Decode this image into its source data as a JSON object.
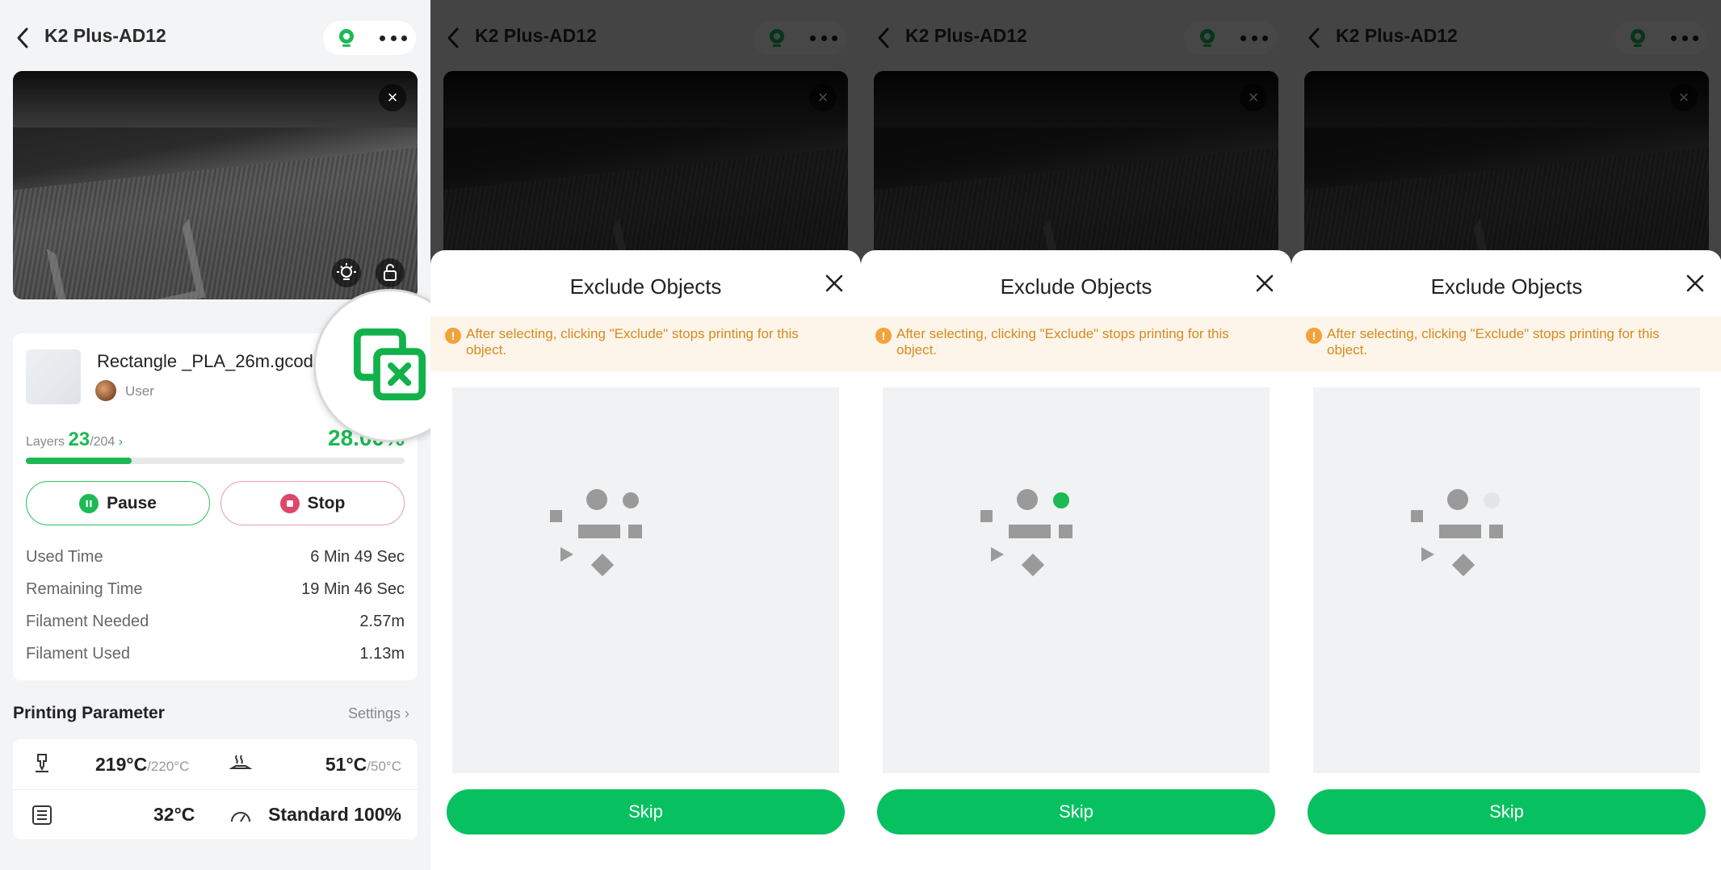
{
  "header": {
    "title": "K2 Plus-AD12"
  },
  "job": {
    "file_name": "Rectangle _PLA_26m.gcode",
    "user": "User",
    "layers_label": "Layers",
    "layers_current": "23",
    "layers_total": "/204",
    "percent": "28.00%",
    "progress": 0.28,
    "pause_label": "Pause",
    "stop_label": "Stop"
  },
  "stats": [
    {
      "label": "Used Time",
      "value": "6 Min  49 Sec"
    },
    {
      "label": "Remaining Time",
      "value": "19 Min  46 Sec"
    },
    {
      "label": "Filament Needed",
      "value": "2.57m"
    },
    {
      "label": "Filament Used",
      "value": "1.13m"
    }
  ],
  "params": {
    "title": "Printing Parameter",
    "settings_link": "Settings",
    "nozzle_temp": "219°C",
    "nozzle_target": "/220°C",
    "bed_temp": "51°C",
    "bed_target": "/50°C",
    "chamber_temp": "32°C",
    "speed": "Standard 100%"
  },
  "modal": {
    "title": "Exclude Objects",
    "warning": "After selecting, clicking \"Exclude\" stops printing for this object.",
    "skip_label": "Skip"
  },
  "colors": {
    "accent": "#07c160",
    "warning_bg": "#fdf5ea",
    "warning_text": "#d68a1f",
    "selected_object": "#1db954",
    "excluded_object": "#e4e5e7"
  },
  "object_states": {
    "panel2": "none selected",
    "panel3": "small circle selected",
    "panel4": "small circle excluded"
  }
}
